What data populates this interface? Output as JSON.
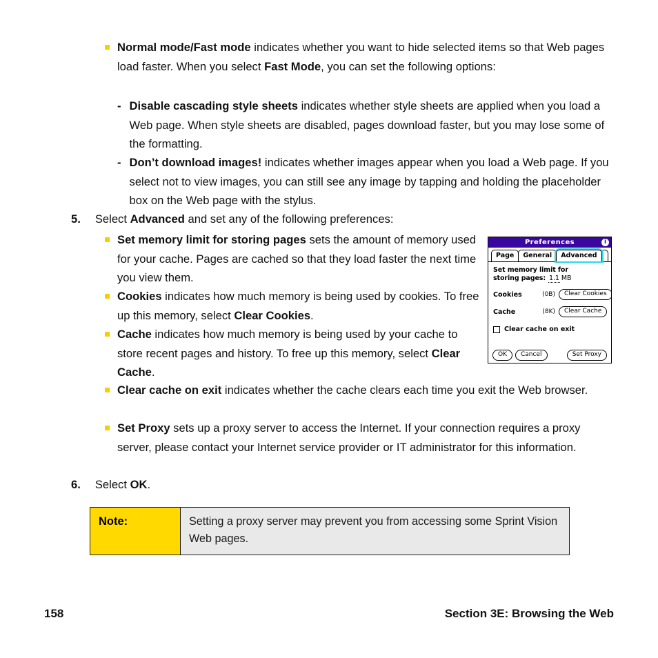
{
  "document": {
    "list_top": [
      {
        "marker": "square",
        "segments": [
          {
            "t": "Normal mode/Fast mode",
            "b": true
          },
          {
            "t": " indicates whether you want to hide selected items so that Web pages load faster. When you select ",
            "b": false
          },
          {
            "t": "Fast Mode",
            "b": true
          },
          {
            "t": ", you can set the following options:",
            "b": false
          }
        ]
      }
    ],
    "sub_items": [
      {
        "marker": "-",
        "segments": [
          {
            "t": "Disable cascading style sheets",
            "b": true
          },
          {
            "t": " indicates whether style sheets are applied when you load a Web page. When style sheets are disabled, pages download faster, but you may lose some of the formatting.",
            "b": false
          }
        ]
      },
      {
        "marker": "-",
        "segments": [
          {
            "t": "Don’t download images!",
            "b": true
          },
          {
            "t": " indicates whether images appear when you load a Web page. If you select not to view images, you can still see any image by tapping and holding the placeholder box on the Web page with the stylus.",
            "b": false
          }
        ]
      }
    ],
    "step_5": {
      "number": "5.",
      "segments": [
        {
          "t": "Select ",
          "b": false
        },
        {
          "t": "Advanced",
          "b": true
        },
        {
          "t": " and set any of the following preferences:",
          "b": false
        }
      ]
    },
    "advanced_bullets": [
      {
        "segments": [
          {
            "t": "Set memory limit for storing pages",
            "b": true
          },
          {
            "t": " sets the amount of memory used for your cache. Pages are cached so that they load faster the next time you view them.",
            "b": false
          }
        ]
      },
      {
        "segments": [
          {
            "t": "Cookies",
            "b": true
          },
          {
            "t": " indicates how much memory is being used by cookies. To free up this memory, select ",
            "b": false
          },
          {
            "t": "Clear Cookies",
            "b": true
          },
          {
            "t": ".",
            "b": false
          }
        ]
      },
      {
        "segments": [
          {
            "t": "Cache",
            "b": true
          },
          {
            "t": " indicates how much memory is being used by your cache to store recent pages and history. To free up this memory, select ",
            "b": false
          },
          {
            "t": "Clear Cache",
            "b": true
          },
          {
            "t": ".",
            "b": false
          }
        ]
      },
      {
        "segments": [
          {
            "t": "Clear cache on exit",
            "b": true
          },
          {
            "t": " indicates whether the cache clears each time you exit the Web browser.",
            "b": false
          }
        ]
      },
      {
        "segments": [
          {
            "t": "Set Proxy",
            "b": true
          },
          {
            "t": " sets up a proxy server to access the Internet. If your connection requires a proxy server, please contact your Internet service provider or IT administrator for this information.",
            "b": false
          }
        ]
      }
    ],
    "step_6": {
      "number": "6.",
      "segments": [
        {
          "t": "Select ",
          "b": false
        },
        {
          "t": "OK",
          "b": true
        },
        {
          "t": ".",
          "b": false
        }
      ]
    },
    "note": {
      "label": "Note:",
      "text": "Setting a proxy server may prevent you from accessing some Sprint Vision Web pages.",
      "label_bg": "#ffd900",
      "body_bg": "#e9e9e9"
    },
    "footer": {
      "page_number": "158",
      "section": "Section 3E: Browsing the Web"
    },
    "bullet_color": "#f5cf00"
  },
  "palm_screenshot": {
    "title": "Preferences",
    "title_bg": "#3a06a0",
    "info_icon_glyph": "i",
    "tabs": [
      {
        "label": "Page",
        "active": false
      },
      {
        "label": "General",
        "active": false
      },
      {
        "label": "Advanced",
        "active": true
      }
    ],
    "active_tab_highlight": "#2fd8e6",
    "memory_limit": {
      "label_line1": "Set memory limit for",
      "label_line2": "storing pages:",
      "value": "1.1",
      "unit": "MB"
    },
    "rows": [
      {
        "label": "Cookies",
        "size": "(0B)",
        "button": "Clear Cookies"
      },
      {
        "label": "Cache",
        "size": "(8K)",
        "button": "Clear Cache"
      }
    ],
    "checkbox": {
      "label": "Clear cache on exit",
      "checked": false
    },
    "footer_buttons": [
      {
        "label": "OK"
      },
      {
        "label": "Cancel"
      },
      {
        "label": "Set Proxy"
      }
    ]
  }
}
